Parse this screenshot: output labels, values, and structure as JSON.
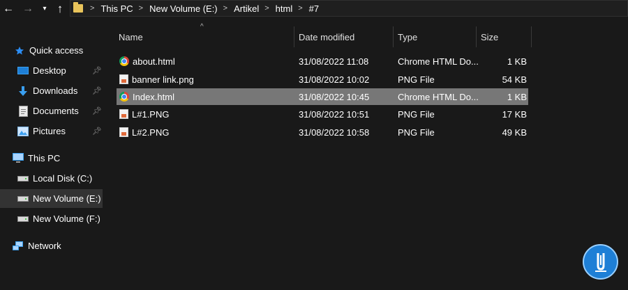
{
  "navigation": {
    "breadcrumbs": [
      "This PC",
      "New Volume (E:)",
      "Artikel",
      "html",
      "#7"
    ]
  },
  "sidebar": {
    "items": [
      {
        "label": "Quick access",
        "icon": "star-icon"
      },
      {
        "label": "Desktop",
        "icon": "desktop-icon",
        "pinned": true
      },
      {
        "label": "Downloads",
        "icon": "download-icon",
        "pinned": true
      },
      {
        "label": "Documents",
        "icon": "documents-icon",
        "pinned": true
      },
      {
        "label": "Pictures",
        "icon": "pictures-icon",
        "pinned": true
      },
      {
        "label": "This PC",
        "icon": "computer-icon"
      },
      {
        "label": "Local Disk (C:)",
        "icon": "drive-icon"
      },
      {
        "label": "New Volume (E:)",
        "icon": "drive-icon",
        "selected": true
      },
      {
        "label": "New Volume (F:)",
        "icon": "drive-icon"
      },
      {
        "label": "Network",
        "icon": "network-icon"
      }
    ]
  },
  "file_list": {
    "columns": {
      "name": "Name",
      "date": "Date modified",
      "type": "Type",
      "size": "Size"
    },
    "rows": [
      {
        "name": "about.html",
        "date": "31/08/2022 11:08",
        "type": "Chrome HTML Do...",
        "size": "1 KB",
        "icon": "chrome-icon"
      },
      {
        "name": "banner link.png",
        "date": "31/08/2022 10:02",
        "type": "PNG File",
        "size": "54 KB",
        "icon": "png-icon"
      },
      {
        "name": "Index.html",
        "date": "31/08/2022 10:45",
        "type": "Chrome HTML Do...",
        "size": "1 KB",
        "icon": "chrome-icon",
        "selected": true
      },
      {
        "name": "L#1.PNG",
        "date": "31/08/2022 10:51",
        "type": "PNG File",
        "size": "17 KB",
        "icon": "png-icon"
      },
      {
        "name": "L#2.PNG",
        "date": "31/08/2022 10:58",
        "type": "PNG File",
        "size": "49 KB",
        "icon": "png-icon"
      }
    ]
  },
  "colors": {
    "background": "#191919",
    "selected_row": "#777777",
    "selected_nav": "#333333",
    "logo": "#1e7fd6"
  }
}
